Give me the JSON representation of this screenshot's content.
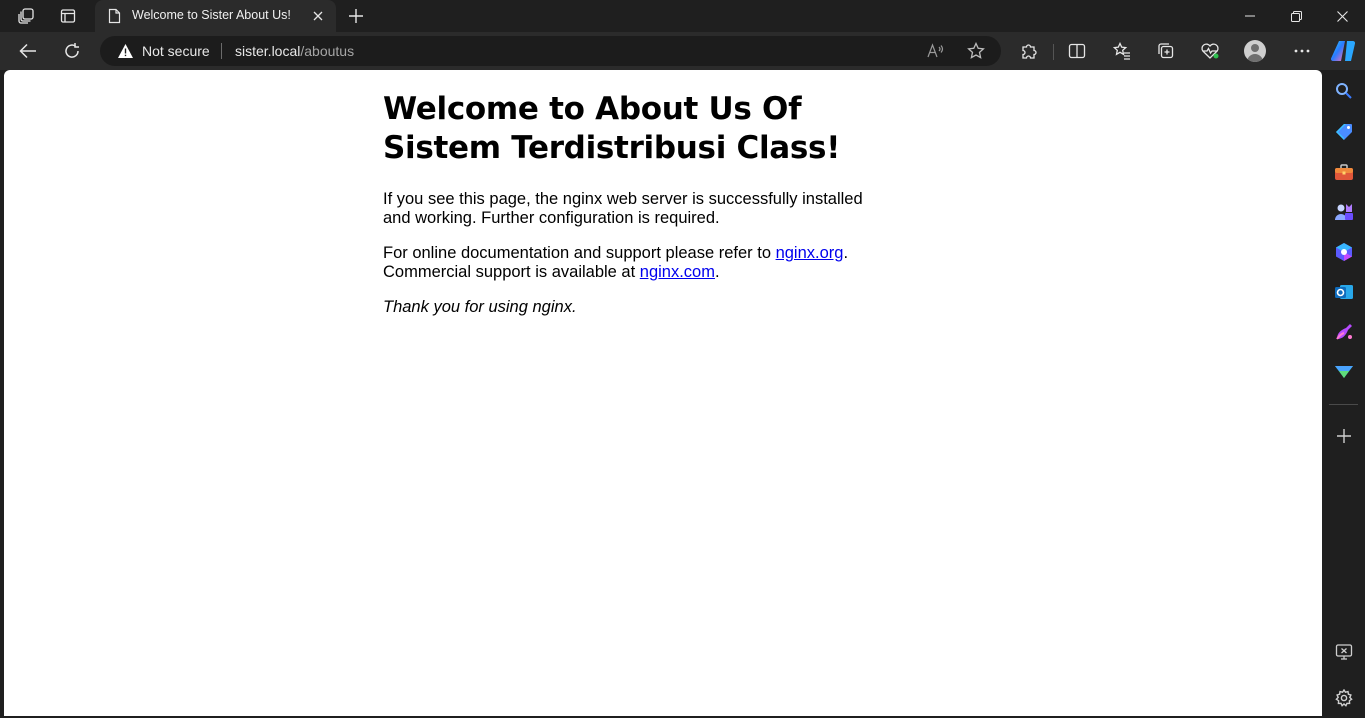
{
  "tab": {
    "title": "Welcome to Sister About Us!"
  },
  "address_bar": {
    "security_label": "Not secure",
    "url_host": "sister.local",
    "url_path": "/aboutus"
  },
  "page": {
    "heading": "Welcome to About Us Of Sistem Terdistribusi Class!",
    "paragraph1": "If you see this page, the nginx web server is successfully installed and working. Further configuration is required.",
    "paragraph2_prefix": "For online documentation and support please refer to ",
    "link1": "nginx.org",
    "paragraph2_mid": ".",
    "paragraph2_line2": "Commercial support is available at ",
    "link2": "nginx.com",
    "paragraph2_suffix": ".",
    "paragraph3": "Thank you for using nginx."
  },
  "colors": {
    "chrome_dark": "#1f1f1f",
    "toolbar": "#2b2b2b",
    "link": "#0000ee",
    "page_bg": "#ffffff"
  },
  "icons": {
    "tabbar": [
      "workspaces-icon",
      "tab-actions-icon",
      "page-icon",
      "close-icon",
      "new-tab-icon",
      "minimize-icon",
      "restore-icon",
      "window-close-icon"
    ],
    "toolbar": [
      "back-icon",
      "refresh-icon",
      "warning-icon",
      "read-aloud-icon",
      "favorite-star-icon",
      "extensions-icon",
      "split-screen-icon",
      "favorites-icon",
      "collections-icon",
      "browser-essentials-icon",
      "profile-avatar",
      "more-icon",
      "copilot-icon"
    ],
    "sidebar": [
      "search-icon",
      "shopping-icon",
      "tools-icon",
      "games-icon",
      "microsoft-365-icon",
      "outlook-icon",
      "designer-icon",
      "drop-icon",
      "add-icon",
      "screenshot-icon",
      "settings-icon"
    ]
  }
}
